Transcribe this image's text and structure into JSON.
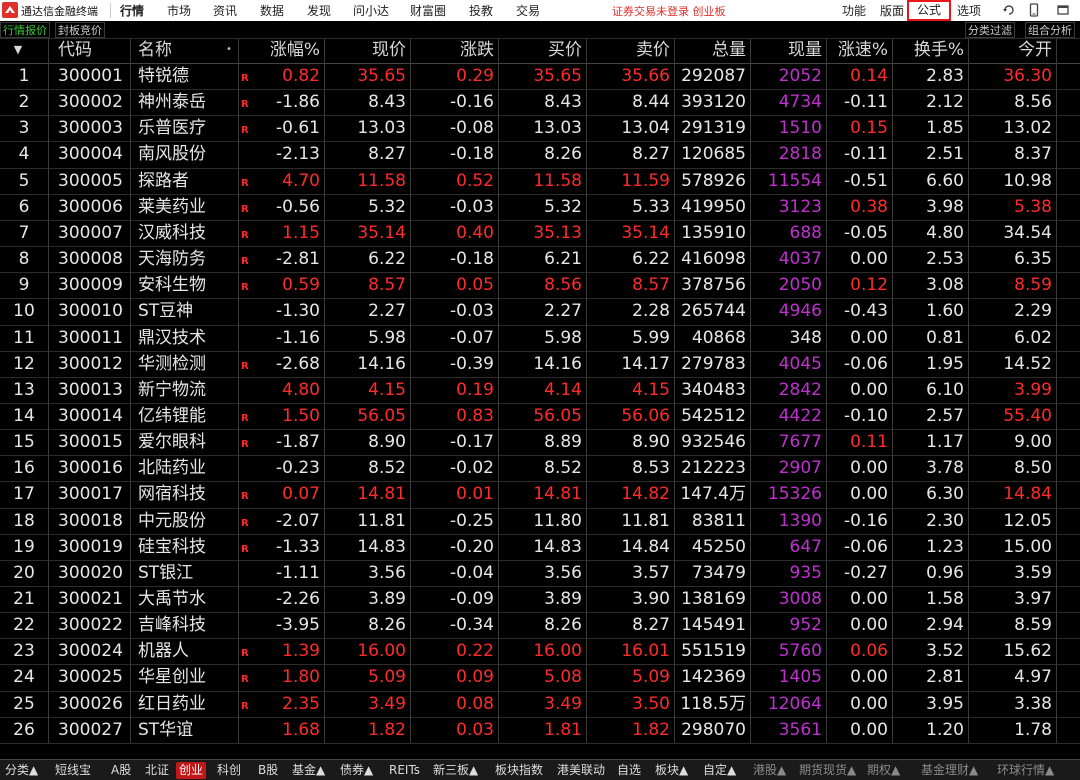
{
  "app": {
    "name": "通达信金融终端",
    "menus": [
      "行情",
      "市场",
      "资讯",
      "数据",
      "发现",
      "问小达",
      "财富圈",
      "投教",
      "交易"
    ],
    "notice": "证券交易未登录  创业板",
    "right_menus": [
      "功能",
      "版面",
      "公式",
      "选项"
    ],
    "icons": [
      "refresh-icon",
      "phone-icon",
      "window-icon"
    ]
  },
  "subtabs": {
    "left": [
      "行情报价",
      "封板竞价"
    ],
    "right": [
      "分类过滤",
      "组合分析"
    ]
  },
  "table": {
    "sort_marker": "▼",
    "columns": [
      "代码",
      "名称",
      "•",
      "涨幅%",
      "现价",
      "涨跌",
      "买价",
      "卖价",
      "总量",
      "现量",
      "涨速%",
      "换手%",
      "今开"
    ],
    "rows": [
      {
        "no": "1",
        "code": "300001",
        "name": "特锐德",
        "r": true,
        "chg_pct": "0.82",
        "price": "35.65",
        "chg": "0.29",
        "bid": "35.65",
        "ask": "35.66",
        "vol": "292087",
        "cur": "2052",
        "speed": "0.14",
        "turn": "2.83",
        "open": "36.30",
        "up": true,
        "speed_up": true,
        "open_up": true
      },
      {
        "no": "2",
        "code": "300002",
        "name": "神州泰岳",
        "r": true,
        "chg_pct": "-1.86",
        "price": "8.43",
        "chg": "-0.16",
        "bid": "8.43",
        "ask": "8.44",
        "vol": "393120",
        "cur": "4734",
        "speed": "-0.11",
        "turn": "2.12",
        "open": "8.56",
        "up": false,
        "speed_up": false,
        "open_up": false
      },
      {
        "no": "3",
        "code": "300003",
        "name": "乐普医疗",
        "r": true,
        "chg_pct": "-0.61",
        "price": "13.03",
        "chg": "-0.08",
        "bid": "13.03",
        "ask": "13.04",
        "vol": "291319",
        "cur": "1510",
        "speed": "0.15",
        "turn": "1.85",
        "open": "13.02",
        "up": false,
        "speed_up": true,
        "open_up": false
      },
      {
        "no": "4",
        "code": "300004",
        "name": "南风股份",
        "r": false,
        "chg_pct": "-2.13",
        "price": "8.27",
        "chg": "-0.18",
        "bid": "8.26",
        "ask": "8.27",
        "vol": "120685",
        "cur": "2818",
        "speed": "-0.11",
        "turn": "2.51",
        "open": "8.37",
        "up": false,
        "speed_up": false,
        "open_up": false
      },
      {
        "no": "5",
        "code": "300005",
        "name": "探路者",
        "r": true,
        "chg_pct": "4.70",
        "price": "11.58",
        "chg": "0.52",
        "bid": "11.58",
        "ask": "11.59",
        "vol": "578926",
        "cur": "11554",
        "speed": "-0.51",
        "turn": "6.60",
        "open": "10.98",
        "up": true,
        "speed_up": false,
        "open_up": false
      },
      {
        "no": "6",
        "code": "300006",
        "name": "莱美药业",
        "r": true,
        "chg_pct": "-0.56",
        "price": "5.32",
        "chg": "-0.03",
        "bid": "5.32",
        "ask": "5.33",
        "vol": "419950",
        "cur": "3123",
        "speed": "0.38",
        "turn": "3.98",
        "open": "5.38",
        "up": false,
        "speed_up": true,
        "open_up": true
      },
      {
        "no": "7",
        "code": "300007",
        "name": "汉威科技",
        "r": true,
        "chg_pct": "1.15",
        "price": "35.14",
        "chg": "0.40",
        "bid": "35.13",
        "ask": "35.14",
        "vol": "135910",
        "cur": "688",
        "speed": "-0.05",
        "turn": "4.80",
        "open": "34.54",
        "up": true,
        "speed_up": false,
        "open_up": false
      },
      {
        "no": "8",
        "code": "300008",
        "name": "天海防务",
        "r": true,
        "chg_pct": "-2.81",
        "price": "6.22",
        "chg": "-0.18",
        "bid": "6.21",
        "ask": "6.22",
        "vol": "416098",
        "cur": "4037",
        "speed": "0.00",
        "turn": "2.53",
        "open": "6.35",
        "up": false,
        "speed_up": null,
        "open_up": false
      },
      {
        "no": "9",
        "code": "300009",
        "name": "安科生物",
        "r": true,
        "chg_pct": "0.59",
        "price": "8.57",
        "chg": "0.05",
        "bid": "8.56",
        "ask": "8.57",
        "vol": "378756",
        "cur": "2050",
        "speed": "0.12",
        "turn": "3.08",
        "open": "8.59",
        "up": true,
        "speed_up": true,
        "open_up": true
      },
      {
        "no": "10",
        "code": "300010",
        "name": "ST豆神",
        "r": false,
        "chg_pct": "-1.30",
        "price": "2.27",
        "chg": "-0.03",
        "bid": "2.27",
        "ask": "2.28",
        "vol": "265744",
        "cur": "4946",
        "speed": "-0.43",
        "turn": "1.60",
        "open": "2.29",
        "up": false,
        "speed_up": false,
        "open_up": false
      },
      {
        "no": "11",
        "code": "300011",
        "name": "鼎汉技术",
        "r": false,
        "chg_pct": "-1.16",
        "price": "5.98",
        "chg": "-0.07",
        "bid": "5.98",
        "ask": "5.99",
        "vol": "40868",
        "cur": "348",
        "speed": "0.00",
        "turn": "0.81",
        "open": "6.02",
        "up": false,
        "speed_up": null,
        "open_up": false,
        "cur_white": true
      },
      {
        "no": "12",
        "code": "300012",
        "name": "华测检测",
        "r": true,
        "chg_pct": "-2.68",
        "price": "14.16",
        "chg": "-0.39",
        "bid": "14.16",
        "ask": "14.17",
        "vol": "279783",
        "cur": "4045",
        "speed": "-0.06",
        "turn": "1.95",
        "open": "14.52",
        "up": false,
        "speed_up": false,
        "open_up": false
      },
      {
        "no": "13",
        "code": "300013",
        "name": "新宁物流",
        "r": false,
        "chg_pct": "4.80",
        "price": "4.15",
        "chg": "0.19",
        "bid": "4.14",
        "ask": "4.15",
        "vol": "340483",
        "cur": "2842",
        "speed": "0.00",
        "turn": "6.10",
        "open": "3.99",
        "up": true,
        "speed_up": null,
        "open_up": true
      },
      {
        "no": "14",
        "code": "300014",
        "name": "亿纬锂能",
        "r": true,
        "chg_pct": "1.50",
        "price": "56.05",
        "chg": "0.83",
        "bid": "56.05",
        "ask": "56.06",
        "vol": "542512",
        "cur": "4422",
        "speed": "-0.10",
        "turn": "2.57",
        "open": "55.40",
        "up": true,
        "speed_up": false,
        "open_up": true
      },
      {
        "no": "15",
        "code": "300015",
        "name": "爱尔眼科",
        "r": true,
        "chg_pct": "-1.87",
        "price": "8.90",
        "chg": "-0.17",
        "bid": "8.89",
        "ask": "8.90",
        "vol": "932546",
        "cur": "7677",
        "speed": "0.11",
        "turn": "1.17",
        "open": "9.00",
        "up": false,
        "speed_up": true,
        "open_up": false
      },
      {
        "no": "16",
        "code": "300016",
        "name": "北陆药业",
        "r": false,
        "chg_pct": "-0.23",
        "price": "8.52",
        "chg": "-0.02",
        "bid": "8.52",
        "ask": "8.53",
        "vol": "212223",
        "cur": "2907",
        "speed": "0.00",
        "turn": "3.78",
        "open": "8.50",
        "up": false,
        "speed_up": null,
        "open_up": false
      },
      {
        "no": "17",
        "code": "300017",
        "name": "网宿科技",
        "r": true,
        "chg_pct": "0.07",
        "price": "14.81",
        "chg": "0.01",
        "bid": "14.81",
        "ask": "14.82",
        "vol": "147.4万",
        "cur": "15326",
        "speed": "0.00",
        "turn": "6.30",
        "open": "14.84",
        "up": true,
        "speed_up": null,
        "open_up": true
      },
      {
        "no": "18",
        "code": "300018",
        "name": "中元股份",
        "r": true,
        "chg_pct": "-2.07",
        "price": "11.81",
        "chg": "-0.25",
        "bid": "11.80",
        "ask": "11.81",
        "vol": "83811",
        "cur": "1390",
        "speed": "-0.16",
        "turn": "2.30",
        "open": "12.05",
        "up": false,
        "speed_up": false,
        "open_up": false
      },
      {
        "no": "19",
        "code": "300019",
        "name": "硅宝科技",
        "r": true,
        "chg_pct": "-1.33",
        "price": "14.83",
        "chg": "-0.20",
        "bid": "14.83",
        "ask": "14.84",
        "vol": "45250",
        "cur": "647",
        "speed": "-0.06",
        "turn": "1.23",
        "open": "15.00",
        "up": false,
        "speed_up": false,
        "open_up": false
      },
      {
        "no": "20",
        "code": "300020",
        "name": "ST银江",
        "r": false,
        "chg_pct": "-1.11",
        "price": "3.56",
        "chg": "-0.04",
        "bid": "3.56",
        "ask": "3.57",
        "vol": "73479",
        "cur": "935",
        "speed": "-0.27",
        "turn": "0.96",
        "open": "3.59",
        "up": false,
        "speed_up": false,
        "open_up": false
      },
      {
        "no": "21",
        "code": "300021",
        "name": "大禹节水",
        "r": false,
        "chg_pct": "-2.26",
        "price": "3.89",
        "chg": "-0.09",
        "bid": "3.89",
        "ask": "3.90",
        "vol": "138169",
        "cur": "3008",
        "speed": "0.00",
        "turn": "1.58",
        "open": "3.97",
        "up": false,
        "speed_up": null,
        "open_up": false
      },
      {
        "no": "22",
        "code": "300022",
        "name": "吉峰科技",
        "r": false,
        "chg_pct": "-3.95",
        "price": "8.26",
        "chg": "-0.34",
        "bid": "8.26",
        "ask": "8.27",
        "vol": "145491",
        "cur": "952",
        "speed": "0.00",
        "turn": "2.94",
        "open": "8.59",
        "up": false,
        "speed_up": null,
        "open_up": false
      },
      {
        "no": "23",
        "code": "300024",
        "name": "机器人",
        "r": true,
        "chg_pct": "1.39",
        "price": "16.00",
        "chg": "0.22",
        "bid": "16.00",
        "ask": "16.01",
        "vol": "551519",
        "cur": "5760",
        "speed": "0.06",
        "turn": "3.52",
        "open": "15.62",
        "up": true,
        "speed_up": true,
        "open_up": false
      },
      {
        "no": "24",
        "code": "300025",
        "name": "华星创业",
        "r": true,
        "chg_pct": "1.80",
        "price": "5.09",
        "chg": "0.09",
        "bid": "5.08",
        "ask": "5.09",
        "vol": "142369",
        "cur": "1405",
        "speed": "0.00",
        "turn": "2.81",
        "open": "4.97",
        "up": true,
        "speed_up": null,
        "open_up": false
      },
      {
        "no": "25",
        "code": "300026",
        "name": "红日药业",
        "r": true,
        "chg_pct": "2.35",
        "price": "3.49",
        "chg": "0.08",
        "bid": "3.49",
        "ask": "3.50",
        "vol": "118.5万",
        "cur": "12064",
        "speed": "0.00",
        "turn": "3.95",
        "open": "3.38",
        "up": true,
        "speed_up": null,
        "open_up": false
      },
      {
        "no": "26",
        "code": "300027",
        "name": "ST华谊",
        "r": false,
        "chg_pct": "1.68",
        "price": "1.82",
        "chg": "0.03",
        "bid": "1.81",
        "ask": "1.82",
        "vol": "298070",
        "cur": "3561",
        "speed": "0.00",
        "turn": "1.20",
        "open": "1.78",
        "up": true,
        "speed_up": null,
        "open_up": false
      }
    ]
  },
  "bottom_tabs": [
    {
      "label": "分类▲",
      "state": "normal"
    },
    {
      "label": "短线宝",
      "state": "normal"
    },
    {
      "label": "A股",
      "state": "normal"
    },
    {
      "label": "北证",
      "state": "normal"
    },
    {
      "label": "创业",
      "state": "active"
    },
    {
      "label": "科创",
      "state": "normal"
    },
    {
      "label": "B股",
      "state": "normal"
    },
    {
      "label": "基金▲",
      "state": "normal"
    },
    {
      "label": "债券▲",
      "state": "normal"
    },
    {
      "label": "REITs",
      "state": "normal"
    },
    {
      "label": "新三板▲",
      "state": "normal"
    },
    {
      "label": "板块指数",
      "state": "normal"
    },
    {
      "label": "港美联动",
      "state": "normal"
    },
    {
      "label": "自选",
      "state": "normal"
    },
    {
      "label": "板块▲",
      "state": "normal"
    },
    {
      "label": "自定▲",
      "state": "normal"
    },
    {
      "label": "港股▲",
      "state": "dim"
    },
    {
      "label": "期货现货▲",
      "state": "dim"
    },
    {
      "label": "期权▲",
      "state": "dim"
    },
    {
      "label": "基金理财▲",
      "state": "dim"
    },
    {
      "label": "环球行情▲",
      "state": "dim"
    }
  ],
  "colors": {
    "up": "#ff2b2b",
    "down": "#e6e6e6",
    "volume_now": "#c030d0",
    "highlight_box": "#e8151b",
    "active_tab": "#c01818"
  }
}
